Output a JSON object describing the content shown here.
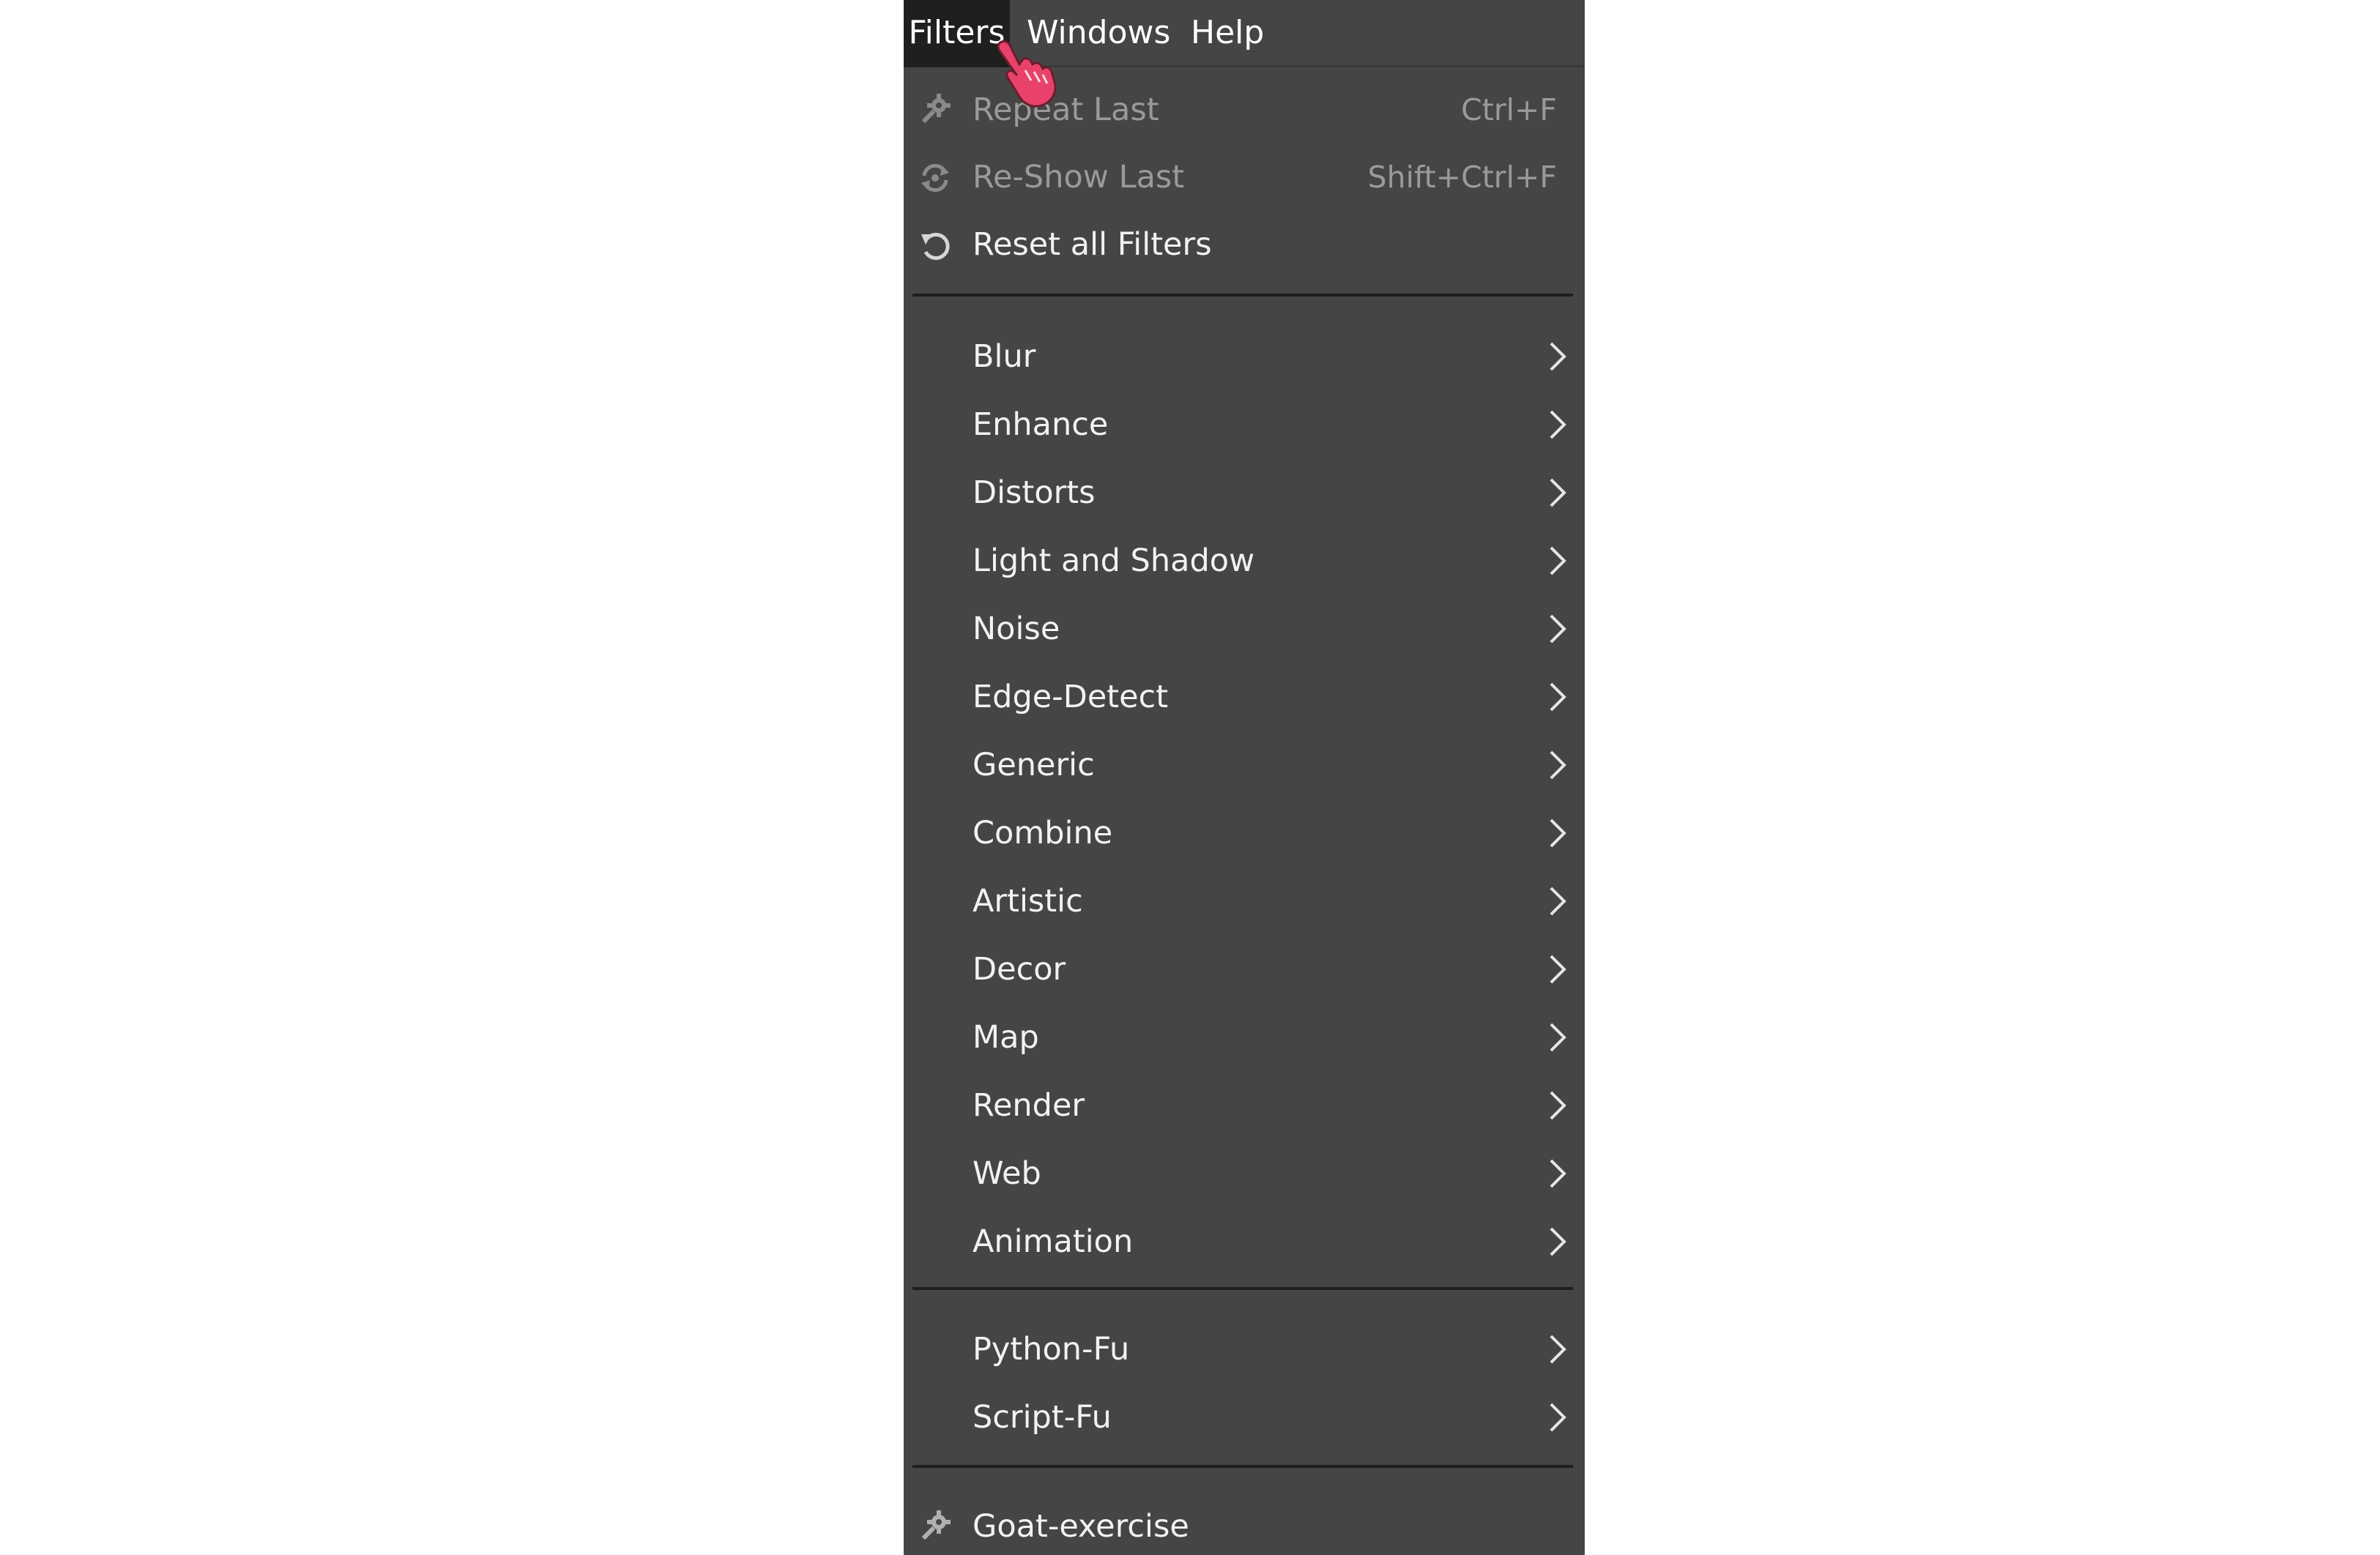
{
  "menubar": {
    "filters": "Filters",
    "windows": "Windows",
    "help": "Help"
  },
  "menu": {
    "repeat_last": {
      "label": "Repeat Last",
      "accel": "Ctrl+F",
      "icon": "gear-icon"
    },
    "reshow_last": {
      "label": "Re-Show Last",
      "accel": "Shift+Ctrl+F",
      "icon": "reshow-icon"
    },
    "reset_all": {
      "label": "Reset all Filters",
      "icon": "reset-icon"
    },
    "blur": "Blur",
    "enhance": "Enhance",
    "distorts": "Distorts",
    "light_and_shadow": "Light and Shadow",
    "noise": "Noise",
    "edge_detect": "Edge-Detect",
    "generic": "Generic",
    "combine": "Combine",
    "artistic": "Artistic",
    "decor": "Decor",
    "map": "Map",
    "render": "Render",
    "web": "Web",
    "animation": "Animation",
    "python_fu": "Python-Fu",
    "script_fu": "Script-Fu",
    "goat_exercise": {
      "label": "Goat-exercise",
      "icon": "gear-icon"
    }
  },
  "colors": {
    "menu_background": "#454545",
    "active_menubar_item": "#1f1f1f",
    "text": "#f2f2f2",
    "disabled_text": "#9a9a9a",
    "separator": "#1e1e1e",
    "cursor": "#e8426a"
  }
}
